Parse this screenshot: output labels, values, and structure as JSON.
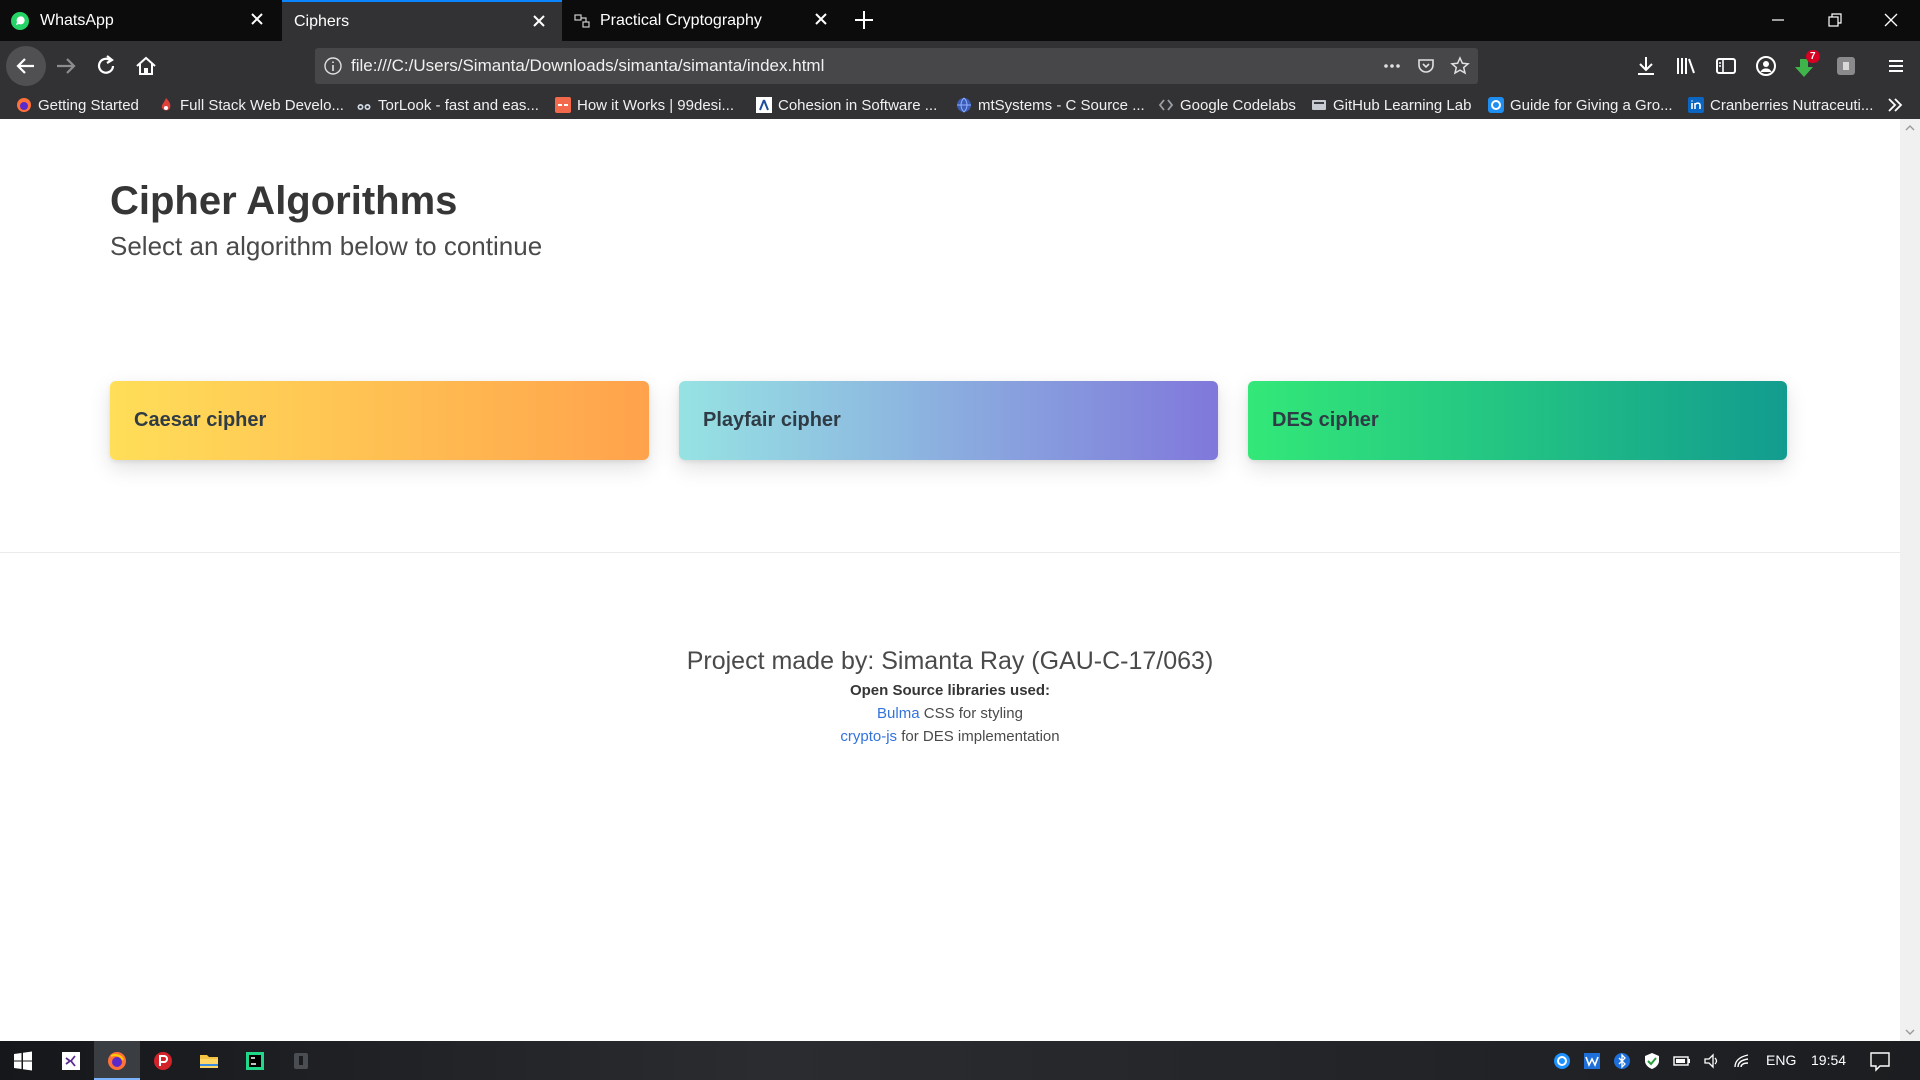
{
  "tabs": [
    {
      "title": "WhatsApp",
      "icon": "whatsapp-icon"
    },
    {
      "title": "Ciphers",
      "icon": ""
    },
    {
      "title": "Practical Cryptography",
      "icon": "cryptography-icon"
    }
  ],
  "url": "file:///C:/Users/Simanta/Downloads/simanta/simanta/index.html",
  "bookmarks": [
    {
      "label": "Getting Started",
      "icon": "firefox-icon"
    },
    {
      "label": "Full Stack Web Develo...",
      "icon": "flame-icon"
    },
    {
      "label": "TorLook - fast and eas...",
      "icon": "binoculars-icon"
    },
    {
      "label": "How it Works | 99desi...",
      "icon": "99designs-icon"
    },
    {
      "label": "Cohesion in Software ...",
      "icon": "cohesion-icon"
    },
    {
      "label": "mtSystems - C Source ...",
      "icon": "globe-icon"
    },
    {
      "label": "Google Codelabs",
      "icon": "codelabs-icon"
    },
    {
      "label": "GitHub Learning Lab",
      "icon": "github-lab-icon"
    },
    {
      "label": "Guide for Giving a Gro...",
      "icon": "circle-icon"
    },
    {
      "label": "Cranberries Nutraceuti...",
      "icon": "linkedin-icon"
    }
  ],
  "hero": {
    "title": "Cipher Algorithms",
    "subtitle": "Select an algorithm below to continue"
  },
  "cards": [
    {
      "label": "Caesar cipher",
      "gradient": [
        "#ffde59",
        "#ffa24c"
      ]
    },
    {
      "label": "Playfair cipher",
      "gradient": [
        "#96e3e3",
        "#8078db"
      ]
    },
    {
      "label": "DES cipher",
      "gradient": [
        "#33e878",
        "#129c8f"
      ]
    }
  ],
  "footer": {
    "credit": "Project made by: Simanta Ray (GAU-C-17/063)",
    "libs_heading": "Open Source libraries used:",
    "libs": [
      {
        "link": "Bulma",
        "text": " CSS for styling"
      },
      {
        "link": "crypto-js",
        "text": " for DES implementation"
      }
    ]
  },
  "tray": {
    "language": "ENG",
    "time": "19:54",
    "download_badge": "7"
  },
  "colors": {
    "accent_link": "#3273dc",
    "active_tab_border": "#0a84ff",
    "chrome_dark": "#0c0c0d",
    "chrome_toolbar": "#323234"
  }
}
